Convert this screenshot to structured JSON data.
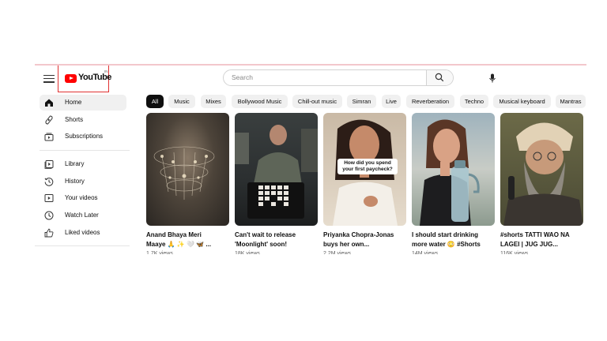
{
  "header": {
    "logo_text": "YouTube",
    "logo_superscript": "IN",
    "search_placeholder": "Search",
    "icons": [
      "menu-icon",
      "search-icon",
      "mic-icon"
    ]
  },
  "sidebar": {
    "items": [
      {
        "label": "Home",
        "icon": "home-icon",
        "active": true
      },
      {
        "label": "Shorts",
        "icon": "shorts-icon"
      },
      {
        "label": "Subscriptions",
        "icon": "subscriptions-icon"
      },
      {
        "label": "Library",
        "icon": "library-icon"
      },
      {
        "label": "History",
        "icon": "history-icon"
      },
      {
        "label": "Your videos",
        "icon": "your-videos-icon"
      },
      {
        "label": "Watch Later",
        "icon": "watch-later-icon"
      },
      {
        "label": "Liked videos",
        "icon": "liked-icon"
      }
    ]
  },
  "chips": [
    "All",
    "Music",
    "Mixes",
    "Bollywood Music",
    "Chill-out music",
    "Simran",
    "Live",
    "Reverberation",
    "Techno",
    "Musical keyboard",
    "Mantras"
  ],
  "videos": [
    {
      "title_line1": "Anand Bhaya Meri",
      "title_line2": "Maaye 🙏 ✨ 🤍 🦋 ...",
      "views": "1.7K views"
    },
    {
      "title_line1": "Can't wait to release",
      "title_line2": "'Moonlight' soon!",
      "views": "18K views"
    },
    {
      "title_line1": "Priyanka Chopra-Jonas",
      "title_line2": "buys her own...",
      "views": "2.2M views",
      "overlay": "How did you spend your first paycheck?"
    },
    {
      "title_line1": "I should start drinking",
      "title_line2": "more water 😳 #Shorts",
      "views": "14M views"
    },
    {
      "title_line1": "#shorts TATTI WAO NA",
      "title_line2": "LAGEI | JUG JUG...",
      "views": "116K views"
    }
  ],
  "colors": {
    "brand_red": "#ff0000",
    "chip_bg": "#f0f0f0",
    "active_chip": "#0f0f0f"
  }
}
